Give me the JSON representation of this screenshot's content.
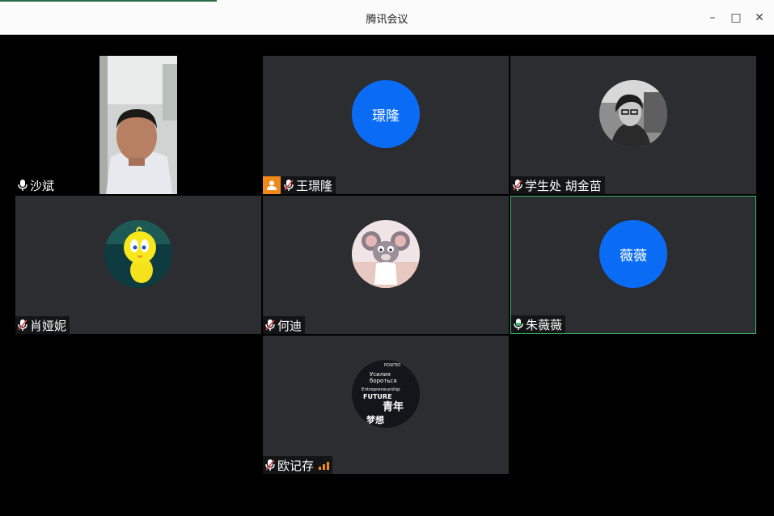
{
  "window": {
    "title": "腾讯会议"
  },
  "window_controls": {
    "minimize": "–",
    "maximize": "□",
    "close": "✕"
  },
  "colors": {
    "avatar_blue": "#0a6cf5",
    "tile_bg": "#2b2d30",
    "active_border": "#3bb56b",
    "host_badge": "#f28a1a",
    "mic_active": "#3bb56b"
  },
  "participants": [
    {
      "name": "沙斌",
      "media": "video",
      "mic": "on"
    },
    {
      "name": "王璟隆",
      "avatar_text": "璟隆",
      "mic": "muted",
      "host": true
    },
    {
      "name": "学生处 胡金苗",
      "media": "photo-avatar",
      "mic": "muted"
    },
    {
      "name": "肖娅妮",
      "media": "cartoon-bird-avatar",
      "mic": "muted"
    },
    {
      "name": "何迪",
      "media": "cartoon-mouse-avatar",
      "mic": "muted"
    },
    {
      "name": "朱薇薇",
      "avatar_text": "薇薇",
      "mic": "speaking",
      "active": true
    },
    {
      "name": "欧记存",
      "media": "poster-avatar",
      "mic": "muted",
      "signal": "weak"
    }
  ],
  "poster_avatar": {
    "line1": "POSITIO",
    "line2": "Усилия",
    "line3": "бороться",
    "line4": "Entrepreneurship",
    "line5": "FUTURE",
    "line6": "青年",
    "line7": "梦想"
  }
}
